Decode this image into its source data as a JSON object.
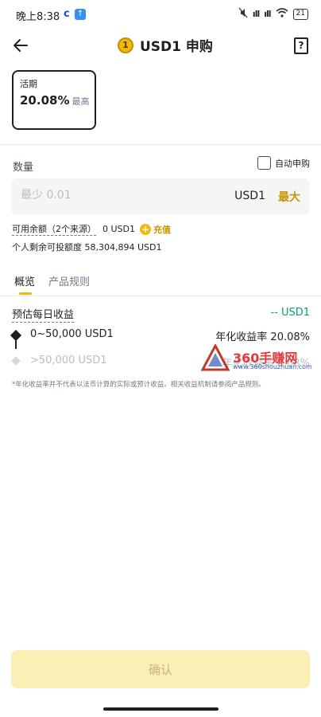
{
  "status_bar": {
    "time": "晚上8:38",
    "app_c": "c",
    "app_icon_glyph": "↑",
    "signal": "ıll",
    "battery": "21"
  },
  "header": {
    "coin_glyph": "1",
    "title": "USD1 申购",
    "help_glyph": "?"
  },
  "term_card": {
    "label": "活期",
    "rate": "20.08%",
    "rate_suffix": "最高"
  },
  "quantity": {
    "label": "数量",
    "auto_subscribe_label": "自动申购",
    "auto_subscribe_checked": false,
    "placeholder": "最少 0.01",
    "unit": "USD1",
    "max_label": "最大"
  },
  "balance": {
    "label": "可用余额（2个来源）",
    "value": "0 USD1",
    "topup_label": "充值",
    "quota_label": "个人剩余可投额度 58,304,894 USD1"
  },
  "tabs": {
    "items": [
      "概览",
      "产品规则"
    ],
    "active_index": 0
  },
  "estimate": {
    "label": "预估每日收益",
    "value": "-- USD1"
  },
  "tiers": [
    {
      "range": "0~50,000 USD1",
      "rate": "年化收益率 20.08%"
    },
    {
      "range": ">50,000 USD1",
      "rate": "年化收益率 0.08%"
    }
  ],
  "watermark": {
    "text": "360手赚网",
    "url": "www.360shouzhuan.com"
  },
  "disclaimer": "*年化收益率并不代表以法币计算的实际或预计收益。相关收益机制请参阅产品规则。",
  "footer": {
    "confirm_label": "确认"
  },
  "colors": {
    "brand_yellow": "#f0b90b",
    "accent_text": "#c99400",
    "positive_green": "#03a66d",
    "confirm_disabled_bg": "#fcefb4"
  }
}
